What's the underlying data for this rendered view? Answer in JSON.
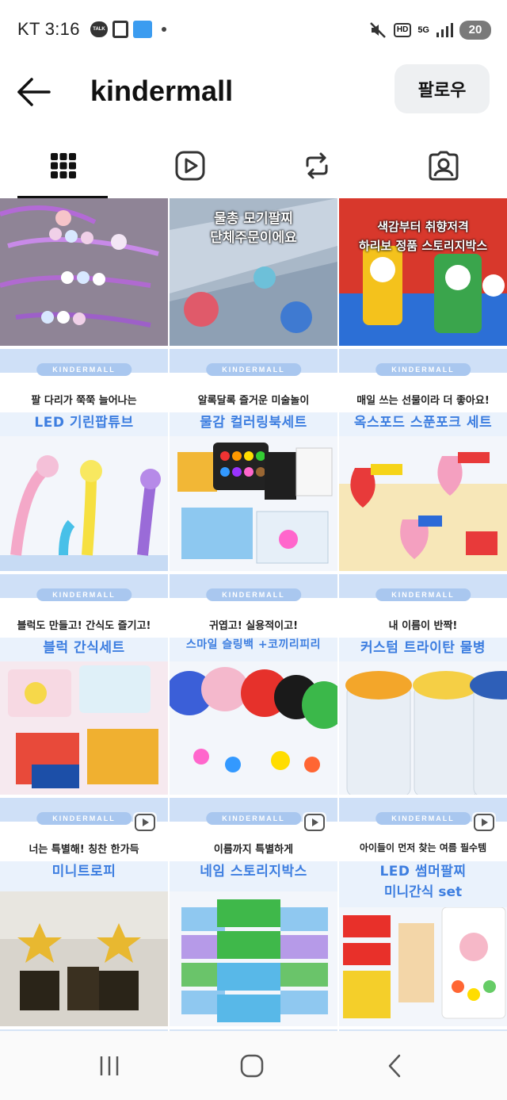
{
  "status_bar": {
    "carrier_time": "KT 3:16",
    "talk_label": "TALK",
    "hd_label": "HD",
    "network_label": "5G",
    "battery": "20"
  },
  "header": {
    "title": "kindermall",
    "follow_label": "팔로우"
  },
  "tabs": [
    "grid-tab",
    "reels-tab",
    "reposts-tab",
    "tagged-tab"
  ],
  "posts": [
    {
      "type": "photo"
    },
    {
      "type": "photo",
      "overlay": [
        "물총 모기팔찌",
        "단체주문이에요"
      ]
    },
    {
      "type": "photo",
      "overlay": [
        "색감부터 취향저격",
        "하리보 정품 스토리지박스"
      ]
    },
    {
      "type": "card",
      "brand": "KINDERMALL",
      "line1": "팔 다리가 쭉쭉 늘어나는",
      "line2": "LED 기린팝튜브"
    },
    {
      "type": "card",
      "brand": "KINDERMALL",
      "line1": "알록달록 즐거운 미술놀이",
      "line2": "물감 컬러링북세트"
    },
    {
      "type": "card",
      "brand": "KINDERMALL",
      "line1": "매일 쓰는 선물이라 더 좋아요!",
      "line2": "옥스포드 스푼포크 세트"
    },
    {
      "type": "card",
      "brand": "KINDERMALL",
      "line1": "블럭도 만들고! 간식도 즐기고!",
      "line2": "블럭 간식세트"
    },
    {
      "type": "card",
      "brand": "KINDERMALL",
      "line1": "귀엽고! 실용적이고!",
      "line2": "스마일 슬링백 +코끼리피리"
    },
    {
      "type": "card",
      "brand": "KINDERMALL",
      "line1": "내 이름이 반짝!",
      "line2": "커스텀 트라이탄 물병"
    },
    {
      "type": "card",
      "brand": "KINDERMALL",
      "line1": "너는 특별해! 칭찬 한가득",
      "line2": "미니트로피",
      "reel": true
    },
    {
      "type": "card",
      "brand": "KINDERMALL",
      "line1": "이름까지 특별하게",
      "line2": "네임 스토리지박스",
      "reel": true
    },
    {
      "type": "card",
      "brand": "KINDERMALL",
      "line1": "아이들이 먼저 찾는 여름 필수템",
      "line2": "LED 썸머팔찌",
      "line3": "미니간식 set",
      "reel": true
    }
  ],
  "colors": {
    "accent_blue": "#3d7ee0",
    "banner_blue": "#cfe0f7",
    "button_bg": "#eef0f2"
  }
}
